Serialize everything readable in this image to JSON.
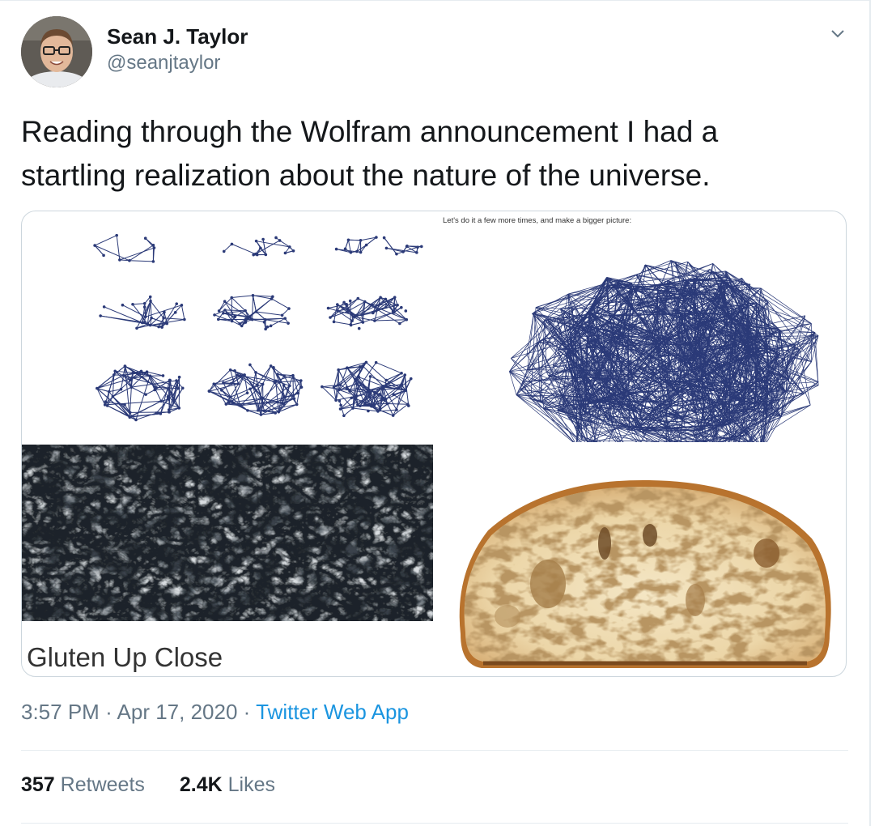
{
  "author": {
    "name": "Sean J. Taylor",
    "handle": "@seanjtaylor"
  },
  "tweet": {
    "text": "Reading through the Wolfram announcement I had a startling realization about the nature of the universe."
  },
  "media": {
    "wolfram_caption": "Let's do it a few more times, and make a bigger picture:",
    "gluten_label": "Gluten Up Close"
  },
  "meta": {
    "time": "3:57 PM",
    "date": "Apr 17, 2020",
    "separator": "·",
    "source": "Twitter Web App"
  },
  "stats": {
    "retweets_count": "357",
    "retweets_label": "Retweets",
    "likes_count": "2.4K",
    "likes_label": "Likes"
  },
  "colors": {
    "link": "#1b95e0",
    "secondary_text": "#657786",
    "graph_stroke": "#2b3a78"
  }
}
